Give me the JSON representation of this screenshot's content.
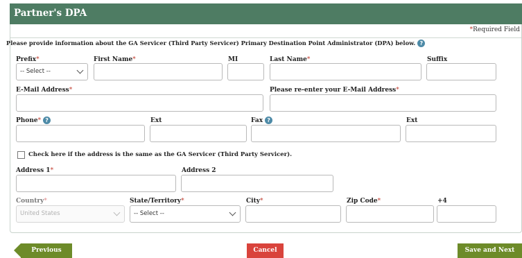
{
  "panel": {
    "title": "Partner's DPA",
    "required_note": {
      "star": "*",
      "text": "Required Field"
    }
  },
  "intro": {
    "text": "Please provide information about the GA Servicer (Third Party Servicer) Primary Destination Point Administrator (DPA) below.",
    "help_icon": "?"
  },
  "fields": {
    "prefix": {
      "label": "Prefix",
      "star": "*",
      "value": "-- Select --"
    },
    "first_name": {
      "label": "First Name",
      "star": "*",
      "value": ""
    },
    "mi": {
      "label": "MI",
      "value": ""
    },
    "last_name": {
      "label": "Last Name",
      "star": "*",
      "value": ""
    },
    "suffix": {
      "label": "Suffix",
      "value": ""
    },
    "email": {
      "label": "E-Mail Address",
      "star": "*",
      "value": ""
    },
    "email_confirm": {
      "label": "Please re-enter your E-Mail Address",
      "star": "*",
      "value": ""
    },
    "phone": {
      "label": "Phone",
      "star": "*",
      "value": ""
    },
    "phone_ext": {
      "label": "Ext",
      "value": ""
    },
    "fax": {
      "label": "Fax",
      "value": ""
    },
    "fax_ext": {
      "label": "Ext",
      "value": ""
    },
    "same_address": {
      "label": "Check here if the address is the same as the GA Servicer (Third Party Servicer).",
      "checked": false
    },
    "address1": {
      "label": "Address 1",
      "star": "*",
      "value": ""
    },
    "address2": {
      "label": "Address 2",
      "value": ""
    },
    "country": {
      "label": "Country",
      "star": "*",
      "value": "United States",
      "disabled": true
    },
    "state": {
      "label": "State/Territory",
      "star": "*",
      "value": "-- Select --"
    },
    "city": {
      "label": "City",
      "star": "*",
      "value": ""
    },
    "zip": {
      "label": "Zip Code",
      "star": "*",
      "value": ""
    },
    "zip4": {
      "label": "+4",
      "value": ""
    }
  },
  "buttons": {
    "previous": "Previous",
    "cancel": "Cancel",
    "save_next": "Save and Next"
  },
  "colors": {
    "header": "#4e7c63",
    "primary_button": "#6d8b29",
    "cancel_button": "#d9433c",
    "required_star": "#c0392b",
    "help_icon": "#4d8aa7"
  }
}
